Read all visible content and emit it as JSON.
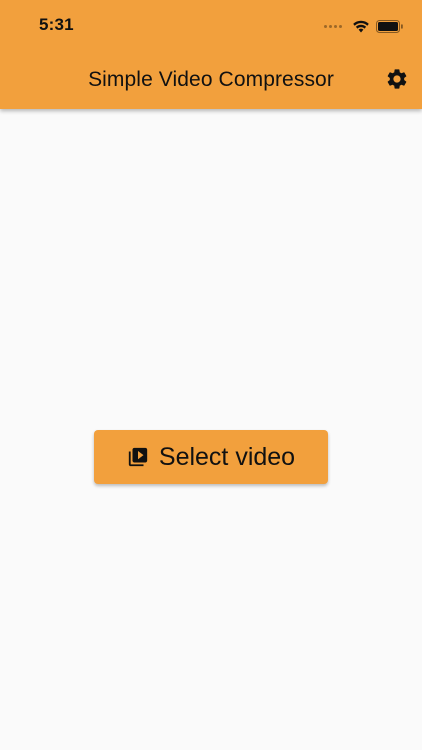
{
  "status_bar": {
    "time": "5:31"
  },
  "app_bar": {
    "title": "Simple Video Compressor",
    "settings_icon": "gear-icon"
  },
  "main": {
    "select_video_label": "Select video",
    "select_video_icon": "video-library-icon"
  },
  "colors": {
    "accent": "#f2a03d",
    "background": "#fafafa",
    "text": "#111111"
  }
}
